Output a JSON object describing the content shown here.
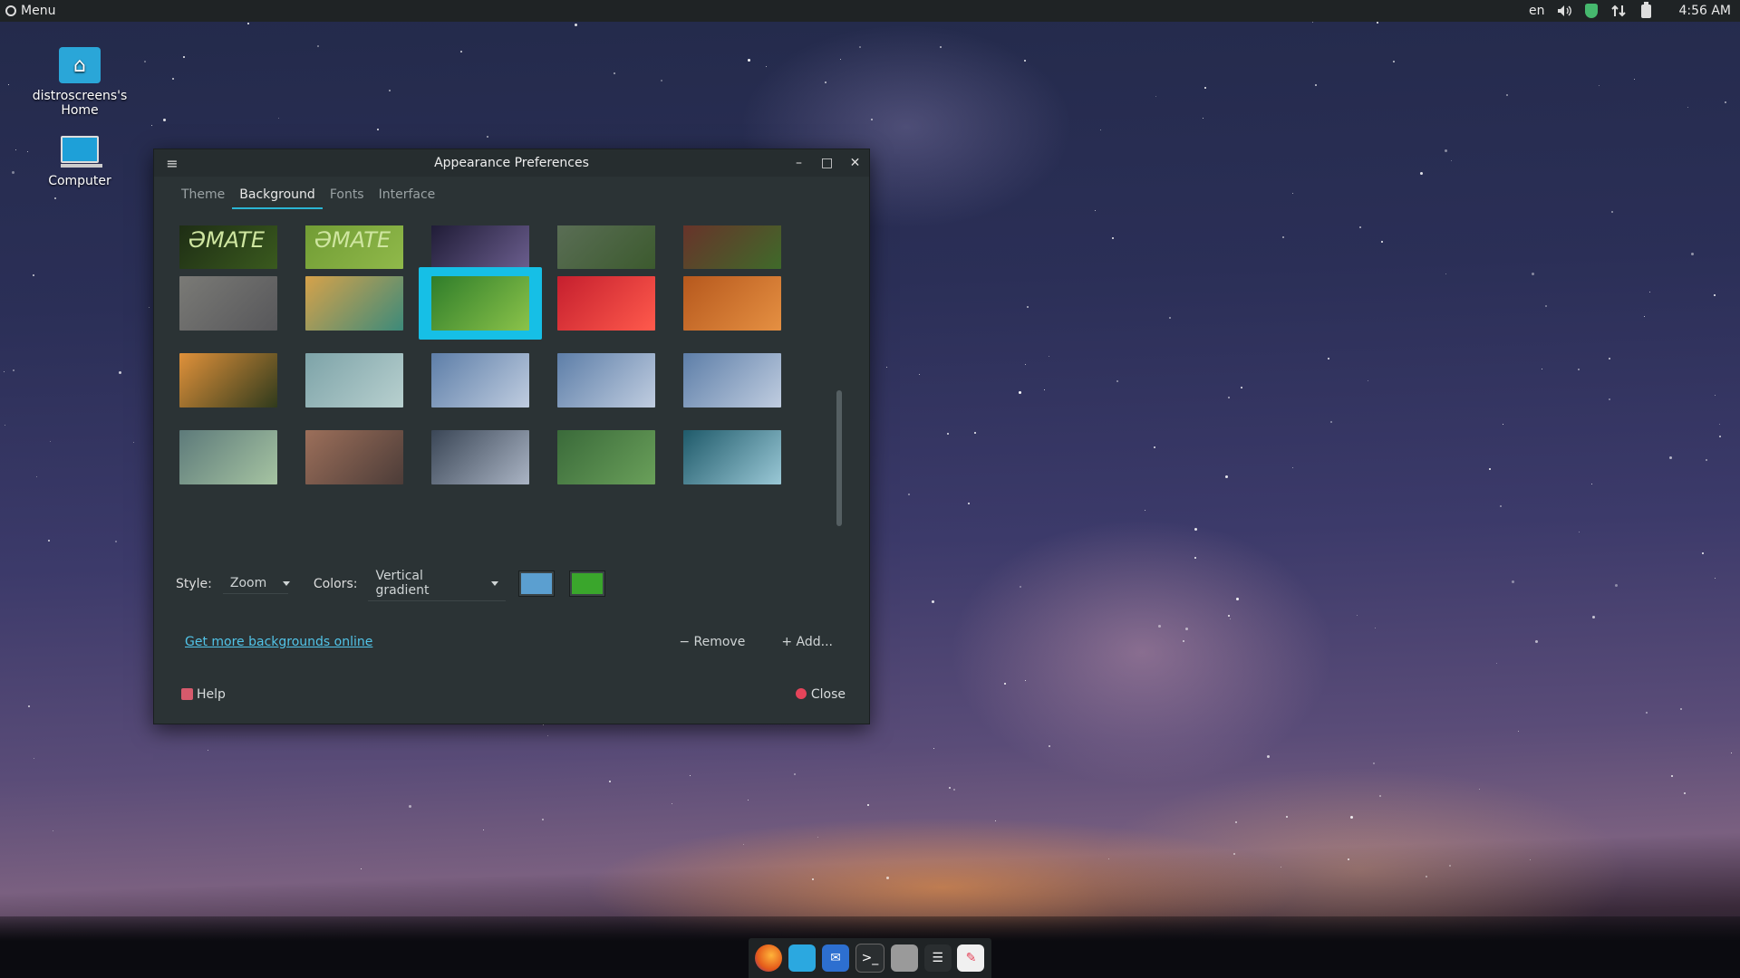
{
  "top_panel": {
    "menu_label": "Menu",
    "lang": "en",
    "clock": "4:56 AM",
    "icons": [
      "volume-icon",
      "shield-icon",
      "network-icon",
      "battery-icon"
    ]
  },
  "desktop": {
    "icons": [
      {
        "label": "distroscreens's Home",
        "icon": "home-folder-icon"
      },
      {
        "label": "Computer",
        "icon": "computer-icon"
      }
    ]
  },
  "window": {
    "title": "Appearance Preferences",
    "tabs": [
      "Theme",
      "Background",
      "Fonts",
      "Interface"
    ],
    "active_tab": "Background",
    "style_label": "Style:",
    "style_value": "Zoom",
    "colors_label": "Colors:",
    "colors_value": "Vertical gradient",
    "color_1": "#5b9fd0",
    "color_2": "#3aa62c",
    "more_link": "Get more backgrounds online",
    "remove_label": "Remove",
    "add_label": "Add...",
    "help_label": "Help",
    "close_label": "Close",
    "wallpapers_selected_index": 7
  },
  "thumbnails": [
    {
      "name": "mate-dark",
      "colors": [
        "#1c2a14",
        "#3a5a1e"
      ],
      "text": "ƏMATE"
    },
    {
      "name": "mate-green",
      "colors": [
        "#6f9a33",
        "#90b94a"
      ],
      "text": "ƏMATE"
    },
    {
      "name": "milky-way",
      "colors": [
        "#1a1730",
        "#6b5e8e"
      ]
    },
    {
      "name": "river-valley",
      "colors": [
        "#5c6f58",
        "#3c5a2e"
      ]
    },
    {
      "name": "forest-red",
      "colors": [
        "#6b2f2a",
        "#3f6a2a"
      ]
    },
    {
      "name": "brick-wall",
      "colors": [
        "#7a7a76",
        "#57575a"
      ]
    },
    {
      "name": "polygon-pattern",
      "colors": [
        "#d6a24a",
        "#3c8a7a"
      ]
    },
    {
      "name": "green-leaf",
      "colors": [
        "#2f7d2a",
        "#8bc34a"
      ]
    },
    {
      "name": "red-flowers",
      "colors": [
        "#c51f2e",
        "#ff5a4c"
      ]
    },
    {
      "name": "desert-dunes",
      "colors": [
        "#b6581d",
        "#e59042"
      ]
    },
    {
      "name": "sunset-river",
      "colors": [
        "#e0913a",
        "#2f3a1c"
      ]
    },
    {
      "name": "soft-waves",
      "colors": [
        "#7da3a8",
        "#b8d0cf"
      ]
    },
    {
      "name": "blue-abstract-1",
      "colors": [
        "#5d7ea8",
        "#c0cde0"
      ]
    },
    {
      "name": "blue-abstract-2",
      "colors": [
        "#5d7ea8",
        "#c0cde0"
      ]
    },
    {
      "name": "blue-abstract-3",
      "colors": [
        "#5d7ea8",
        "#c0cde0"
      ]
    },
    {
      "name": "green-mist",
      "colors": [
        "#5d7a7a",
        "#a6c4a2"
      ]
    },
    {
      "name": "bookshelf",
      "colors": [
        "#9c6f5a",
        "#4c3c38"
      ]
    },
    {
      "name": "storm-sea",
      "colors": [
        "#3a4656",
        "#aab4c4"
      ]
    },
    {
      "name": "green-lines",
      "colors": [
        "#3a6a3a",
        "#6aa05a"
      ]
    },
    {
      "name": "cloud-sky",
      "colors": [
        "#1f5a6a",
        "#9ac8d6"
      ]
    },
    {
      "name": "palm-teal",
      "colors": [
        "#1bd0c8",
        "#8a3a1a"
      ]
    },
    {
      "name": "orange-petals",
      "colors": [
        "#e27f1a",
        "#3a2a14"
      ]
    },
    {
      "name": "aurora-1",
      "colors": [
        "#1a2a20",
        "#4c8a3a"
      ]
    },
    {
      "name": "dark-green",
      "colors": [
        "#0f1a0e",
        "#1c2a14"
      ]
    },
    {
      "name": "aurora-2",
      "colors": [
        "#1a2a20",
        "#4c9a3a"
      ]
    }
  ],
  "dock": [
    "firefox-icon",
    "files-icon",
    "messenger-icon",
    "terminal-icon",
    "text-editor-icon",
    "task-list-icon",
    "appearance-icon"
  ]
}
